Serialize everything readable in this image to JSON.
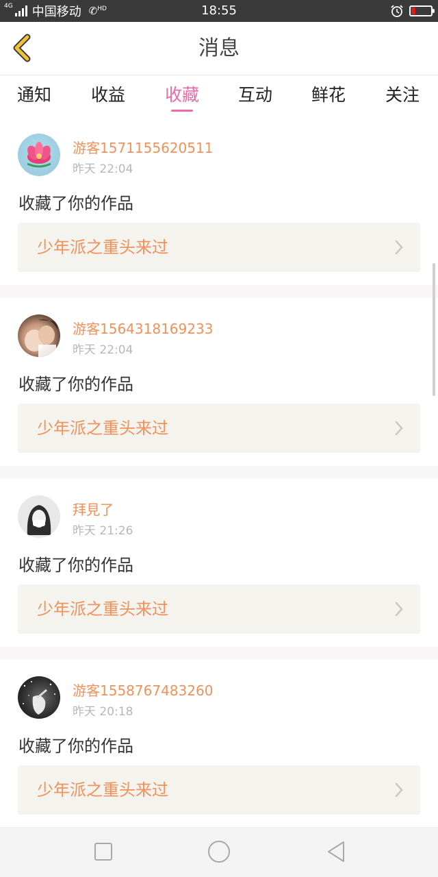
{
  "status_bar": {
    "network": "4G",
    "carrier": "中国移动",
    "hd": "HD",
    "time": "18:55",
    "battery_color": "#e01a1a"
  },
  "header": {
    "title": "消息",
    "back_icon": "chevron-left-icon",
    "accent_color": "#f1c232"
  },
  "tabs": [
    {
      "label": "通知",
      "active": false
    },
    {
      "label": "收益",
      "active": false
    },
    {
      "label": "收藏",
      "active": true
    },
    {
      "label": "互动",
      "active": false
    },
    {
      "label": "鲜花",
      "active": false
    },
    {
      "label": "关注",
      "active": false
    }
  ],
  "colors": {
    "active_tab": "#ec6aa8",
    "username": "#f0915a",
    "work_title": "#f0915a",
    "work_box_bg": "#f4f3ee"
  },
  "messages": [
    {
      "username": "游客1571155620511",
      "time": "昨天 22:04",
      "action": "收藏了你的作品",
      "work_title": "少年派之重头来过",
      "avatar": "lotus-avatar"
    },
    {
      "username": "游客1564318169233",
      "time": "昨天 22:04",
      "action": "收藏了你的作品",
      "work_title": "少年派之重头来过",
      "avatar": "photo-avatar"
    },
    {
      "username": "拜見了",
      "time": "昨天 21:26",
      "action": "收藏了你的作品",
      "work_title": "少年派之重头来过",
      "avatar": "girl-avatar"
    },
    {
      "username": "游客1558767483260",
      "time": "昨天 20:18",
      "action": "收藏了你的作品",
      "work_title": "少年派之重头来过",
      "avatar": "dark-avatar"
    }
  ],
  "nav_bar": {
    "recent_icon": "square-icon",
    "home_icon": "circle-icon",
    "back_icon": "triangle-back-icon"
  }
}
